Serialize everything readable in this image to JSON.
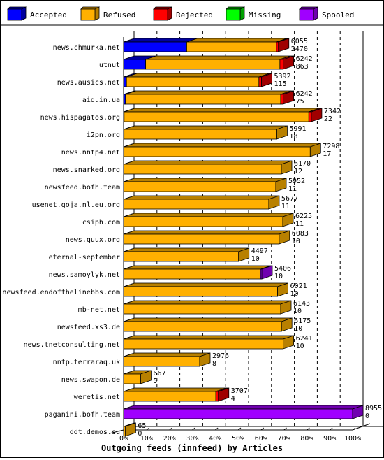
{
  "chart_data": {
    "type": "bar",
    "orientation": "horizontal",
    "stacked": true,
    "title": "",
    "xlabel": "Outgoing feeds (innfeed) by Articles",
    "ylabel": "",
    "xlim": [
      0,
      100
    ],
    "x_tick_labels": [
      "0%",
      "10%",
      "20%",
      "30%",
      "40%",
      "50%",
      "60%",
      "70%",
      "80%",
      "90%",
      "100%"
    ],
    "scale_max_articles": 8955,
    "legend_position": "top",
    "legend": [
      {
        "name": "Accepted",
        "color": "#0000ff",
        "side": "#0000a0"
      },
      {
        "name": "Refused",
        "color": "#ffb000",
        "side": "#b88000"
      },
      {
        "name": "Rejected",
        "color": "#ff0000",
        "side": "#a00000"
      },
      {
        "name": "Missing",
        "color": "#00ff00",
        "side": "#00a000"
      },
      {
        "name": "Spooled",
        "color": "#a000ff",
        "side": "#7000b0"
      }
    ],
    "categories": [
      "news.chmurka.net",
      "utnut",
      "news.ausics.net",
      "aid.in.ua",
      "news.hispagatos.org",
      "i2pn.org",
      "news.nntp4.net",
      "news.snarked.org",
      "newsfeed.bofh.team",
      "usenet.goja.nl.eu.org",
      "csiph.com",
      "news.quux.org",
      "eternal-september",
      "news.samoylyk.net",
      "newsfeed.endofthelinebbs.com",
      "mb-net.net",
      "newsfeed.xs3.de",
      "news.tnetconsulting.net",
      "nntp.terraraq.uk",
      "news.swapon.de",
      "weretis.net",
      "paganini.bofh.team",
      "ddt.demos.su"
    ],
    "totals": [
      6055,
      6242,
      5392,
      6242,
      7342,
      5991,
      7298,
      6170,
      5952,
      5677,
      6225,
      6083,
      4497,
      5406,
      6021,
      6143,
      6175,
      6241,
      2976,
      667,
      3707,
      8955,
      65
    ],
    "accepted_labels": [
      2470,
      863,
      115,
      75,
      22,
      18,
      17,
      12,
      11,
      11,
      11,
      10,
      10,
      10,
      10,
      10,
      10,
      10,
      8,
      5,
      4,
      0,
      0
    ],
    "series": [
      {
        "name": "Accepted",
        "values": [
          2470,
          863,
          115,
          75,
          22,
          18,
          17,
          12,
          11,
          11,
          11,
          10,
          10,
          10,
          10,
          10,
          10,
          10,
          8,
          5,
          4,
          0,
          0
        ]
      },
      {
        "name": "Refused",
        "values": [
          3505,
          5249,
          5177,
          6067,
          7220,
          5973,
          7281,
          6158,
          5941,
          5666,
          6214,
          6073,
          4487,
          5346,
          6011,
          6133,
          6165,
          6231,
          2968,
          662,
          3603,
          0,
          65
        ]
      },
      {
        "name": "Rejected",
        "values": [
          80,
          130,
          100,
          100,
          100,
          0,
          0,
          0,
          0,
          0,
          0,
          0,
          0,
          0,
          0,
          0,
          0,
          0,
          0,
          0,
          100,
          0,
          0
        ]
      },
      {
        "name": "Missing",
        "values": [
          0,
          0,
          0,
          0,
          0,
          0,
          0,
          0,
          0,
          0,
          0,
          0,
          0,
          0,
          0,
          0,
          0,
          0,
          0,
          0,
          0,
          0,
          0
        ]
      },
      {
        "name": "Spooled",
        "values": [
          0,
          0,
          0,
          0,
          0,
          0,
          0,
          0,
          0,
          0,
          0,
          0,
          0,
          50,
          0,
          0,
          0,
          0,
          0,
          0,
          0,
          8955,
          0
        ]
      }
    ]
  }
}
